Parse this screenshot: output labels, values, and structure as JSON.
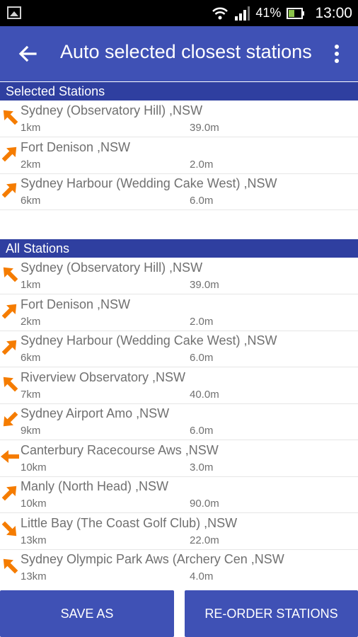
{
  "status_bar": {
    "battery": "41%",
    "time": "13:00"
  },
  "app_bar": {
    "title": "Auto selected closest stations"
  },
  "colors": {
    "primary": "#3f51b5",
    "header": "#2f3fa0",
    "arrow": "#f57c00",
    "text": "#707070"
  },
  "selected_section": {
    "title": "Selected Stations",
    "items": [
      {
        "name": "Sydney (Observatory Hill) ,NSW",
        "distance": "1km",
        "height": "39.0m",
        "direction": "nw"
      },
      {
        "name": "Fort Denison ,NSW",
        "distance": "2km",
        "height": "2.0m",
        "direction": "ne"
      },
      {
        "name": "Sydney Harbour (Wedding Cake West) ,NSW",
        "distance": "6km",
        "height": "6.0m",
        "direction": "ne"
      }
    ]
  },
  "all_section": {
    "title": "All Stations",
    "items": [
      {
        "name": "Sydney (Observatory Hill) ,NSW",
        "distance": "1km",
        "height": "39.0m",
        "direction": "nw"
      },
      {
        "name": "Fort Denison ,NSW",
        "distance": "2km",
        "height": "2.0m",
        "direction": "ne"
      },
      {
        "name": "Sydney Harbour (Wedding Cake West) ,NSW",
        "distance": "6km",
        "height": "6.0m",
        "direction": "ne"
      },
      {
        "name": "Riverview Observatory ,NSW",
        "distance": "7km",
        "height": "40.0m",
        "direction": "nw"
      },
      {
        "name": "Sydney Airport Amo ,NSW",
        "distance": "9km",
        "height": "6.0m",
        "direction": "sw"
      },
      {
        "name": "Canterbury Racecourse Aws ,NSW",
        "distance": "10km",
        "height": "3.0m",
        "direction": "w"
      },
      {
        "name": "Manly (North Head) ,NSW",
        "distance": "10km",
        "height": "90.0m",
        "direction": "ne"
      },
      {
        "name": "Little Bay (The Coast Golf Club) ,NSW",
        "distance": "13km",
        "height": "22.0m",
        "direction": "se"
      },
      {
        "name": "Sydney Olympic Park Aws (Archery Cen ,NSW",
        "distance": "13km",
        "height": "4.0m",
        "direction": "nw"
      }
    ]
  },
  "buttons": {
    "save_as": "SAVE AS",
    "reorder": "RE-ORDER STATIONS"
  }
}
